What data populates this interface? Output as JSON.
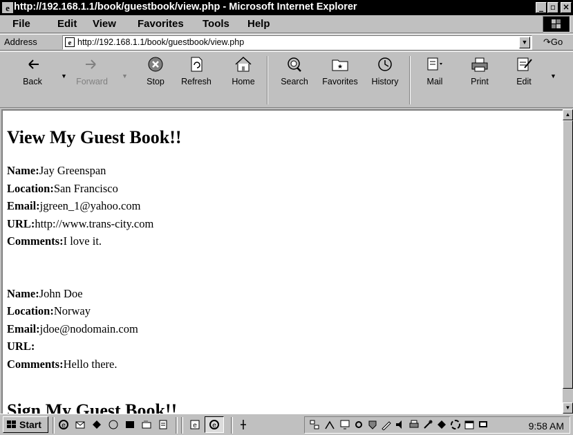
{
  "window": {
    "title": "http://192.168.1.1/book/guestbook/view.php - Microsoft Internet Explorer",
    "controls": [
      "minimize-icon",
      "maximize-icon",
      "close-icon"
    ]
  },
  "menu": {
    "items": [
      {
        "label": "File"
      },
      {
        "label": "Edit"
      },
      {
        "label": "View"
      },
      {
        "label": "Favorites"
      },
      {
        "label": "Tools"
      },
      {
        "label": "Help"
      }
    ]
  },
  "address": {
    "label": "Address",
    "url": "http://192.168.1.1/book/guestbook/view.php",
    "go_label": "Go"
  },
  "toolbar": {
    "buttons": [
      {
        "label": "Back",
        "icon": "back-arrow-icon"
      },
      {
        "label": "Forward",
        "icon": "forward-arrow-icon",
        "disabled": true
      },
      {
        "label": "Stop",
        "icon": "stop-icon"
      },
      {
        "label": "Refresh",
        "icon": "refresh-icon"
      },
      {
        "label": "Home",
        "icon": "home-icon"
      },
      {
        "label": "Search",
        "icon": "search-icon"
      },
      {
        "label": "Favorites",
        "icon": "favorites-icon"
      },
      {
        "label": "History",
        "icon": "history-icon"
      },
      {
        "label": "Mail",
        "icon": "mail-icon"
      },
      {
        "label": "Print",
        "icon": "print-icon"
      },
      {
        "label": "Edit",
        "icon": "edit-icon"
      }
    ]
  },
  "page": {
    "heading": "View My Guest Book!!",
    "field_labels": {
      "name": "Name:",
      "location": "Location:",
      "email": "Email:",
      "url": "URL:",
      "comments": "Comments:"
    },
    "entries": [
      {
        "name": "Jay Greenspan",
        "location": "San Francisco",
        "email": "jgreen_1@yahoo.com",
        "url": "http://www.trans-city.com",
        "comments": "I love it."
      },
      {
        "name": "John Doe",
        "location": "Norway",
        "email": "jdoe@nodomain.com",
        "url": "",
        "comments": "Hello there."
      }
    ],
    "cut_heading": "Sign My Guest Book!!"
  },
  "taskbar": {
    "start_label": "Start",
    "clock": "9:58 AM"
  },
  "colors": {
    "titlebar": "#000000",
    "chrome": "#c0c0c0",
    "page_bg": "#ffffff"
  }
}
